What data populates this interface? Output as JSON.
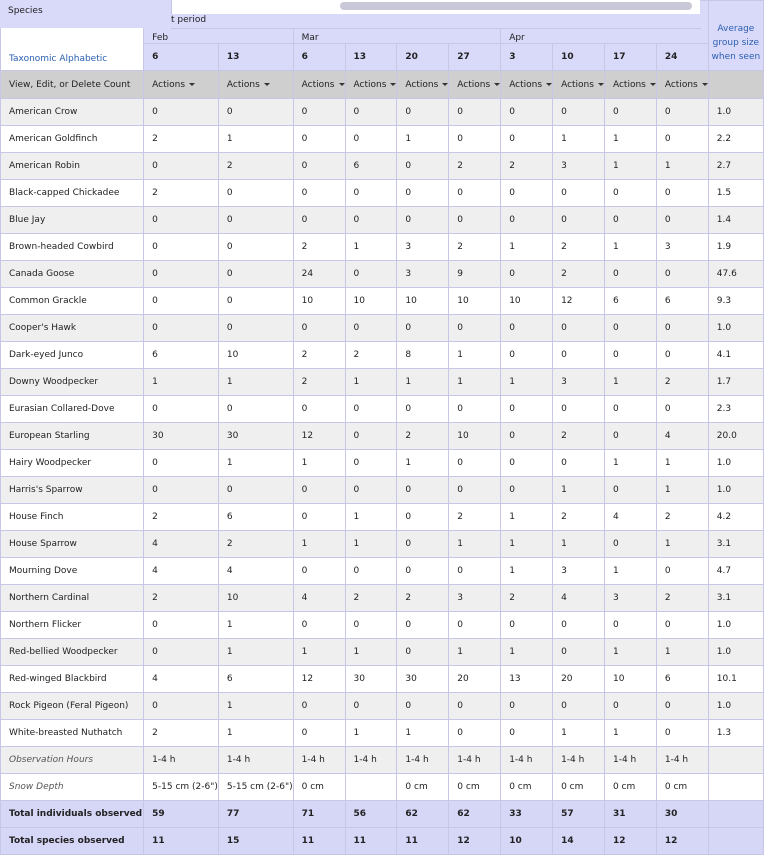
{
  "header": {
    "species_label": "Species",
    "period_label": "t period",
    "taxonomic_label": "Taxonomic Alphabetic",
    "avg_label": "Average group size when seen",
    "actions_row_label": "View, Edit, or Delete Count",
    "actions_label": "Actions",
    "months": [
      {
        "name": "Feb",
        "span": 2
      },
      {
        "name": "Mar",
        "span": 4
      },
      {
        "name": "Apr",
        "span": 4
      }
    ],
    "days": [
      "6",
      "13",
      "6",
      "13",
      "20",
      "27",
      "3",
      "10",
      "17",
      "24"
    ]
  },
  "rows": [
    {
      "species": "American Crow",
      "values": [
        "0",
        "0",
        "0",
        "0",
        "0",
        "0",
        "0",
        "0",
        "0",
        "0"
      ],
      "avg": "1.0"
    },
    {
      "species": "American Goldfinch",
      "values": [
        "2",
        "1",
        "0",
        "0",
        "1",
        "0",
        "0",
        "1",
        "1",
        "0"
      ],
      "avg": "2.2"
    },
    {
      "species": "American Robin",
      "values": [
        "0",
        "2",
        "0",
        "6",
        "0",
        "2",
        "2",
        "3",
        "1",
        "1"
      ],
      "avg": "2.7"
    },
    {
      "species": "Black-capped Chickadee",
      "values": [
        "2",
        "0",
        "0",
        "0",
        "0",
        "0",
        "0",
        "0",
        "0",
        "0"
      ],
      "avg": "1.5"
    },
    {
      "species": "Blue Jay",
      "values": [
        "0",
        "0",
        "0",
        "0",
        "0",
        "0",
        "0",
        "0",
        "0",
        "0"
      ],
      "avg": "1.4"
    },
    {
      "species": "Brown-headed Cowbird",
      "values": [
        "0",
        "0",
        "2",
        "1",
        "3",
        "2",
        "1",
        "2",
        "1",
        "3"
      ],
      "avg": "1.9"
    },
    {
      "species": "Canada Goose",
      "values": [
        "0",
        "0",
        "24",
        "0",
        "3",
        "9",
        "0",
        "2",
        "0",
        "0"
      ],
      "avg": "47.6"
    },
    {
      "species": "Common Grackle",
      "values": [
        "0",
        "0",
        "10",
        "10",
        "10",
        "10",
        "10",
        "12",
        "6",
        "6"
      ],
      "avg": "9.3"
    },
    {
      "species": "Cooper's Hawk",
      "values": [
        "0",
        "0",
        "0",
        "0",
        "0",
        "0",
        "0",
        "0",
        "0",
        "0"
      ],
      "avg": "1.0"
    },
    {
      "species": "Dark-eyed Junco",
      "values": [
        "6",
        "10",
        "2",
        "2",
        "8",
        "1",
        "0",
        "0",
        "0",
        "0"
      ],
      "avg": "4.1"
    },
    {
      "species": "Downy Woodpecker",
      "values": [
        "1",
        "1",
        "2",
        "1",
        "1",
        "1",
        "1",
        "3",
        "1",
        "2"
      ],
      "avg": "1.7"
    },
    {
      "species": "Eurasian Collared-Dove",
      "values": [
        "0",
        "0",
        "0",
        "0",
        "0",
        "0",
        "0",
        "0",
        "0",
        "0"
      ],
      "avg": "2.3"
    },
    {
      "species": "European Starling",
      "values": [
        "30",
        "30",
        "12",
        "0",
        "2",
        "10",
        "0",
        "2",
        "0",
        "4"
      ],
      "avg": "20.0"
    },
    {
      "species": "Hairy Woodpecker",
      "values": [
        "0",
        "1",
        "1",
        "0",
        "1",
        "0",
        "0",
        "0",
        "1",
        "1"
      ],
      "avg": "1.0"
    },
    {
      "species": "Harris's Sparrow",
      "values": [
        "0",
        "0",
        "0",
        "0",
        "0",
        "0",
        "0",
        "1",
        "0",
        "1"
      ],
      "avg": "1.0"
    },
    {
      "species": "House Finch",
      "values": [
        "2",
        "6",
        "0",
        "1",
        "0",
        "2",
        "1",
        "2",
        "4",
        "2"
      ],
      "avg": "4.2"
    },
    {
      "species": "House Sparrow",
      "values": [
        "4",
        "2",
        "1",
        "1",
        "0",
        "1",
        "1",
        "1",
        "0",
        "1"
      ],
      "avg": "3.1"
    },
    {
      "species": "Mourning Dove",
      "values": [
        "4",
        "4",
        "0",
        "0",
        "0",
        "0",
        "1",
        "3",
        "1",
        "0"
      ],
      "avg": "4.7"
    },
    {
      "species": "Northern Cardinal",
      "values": [
        "2",
        "10",
        "4",
        "2",
        "2",
        "3",
        "2",
        "4",
        "3",
        "2"
      ],
      "avg": "3.1"
    },
    {
      "species": "Northern Flicker",
      "values": [
        "0",
        "1",
        "0",
        "0",
        "0",
        "0",
        "0",
        "0",
        "0",
        "0"
      ],
      "avg": "1.0"
    },
    {
      "species": "Red-bellied Woodpecker",
      "values": [
        "0",
        "1",
        "1",
        "1",
        "0",
        "1",
        "1",
        "0",
        "1",
        "1"
      ],
      "avg": "1.0"
    },
    {
      "species": "Red-winged Blackbird",
      "values": [
        "4",
        "6",
        "12",
        "30",
        "30",
        "20",
        "13",
        "20",
        "10",
        "6"
      ],
      "avg": "10.1"
    },
    {
      "species": "Rock Pigeon (Feral Pigeon)",
      "values": [
        "0",
        "1",
        "0",
        "0",
        "0",
        "0",
        "0",
        "0",
        "0",
        "0"
      ],
      "avg": "1.0"
    },
    {
      "species": "White-breasted Nuthatch",
      "values": [
        "2",
        "1",
        "0",
        "1",
        "1",
        "0",
        "0",
        "1",
        "1",
        "0"
      ],
      "avg": "1.3"
    }
  ],
  "meta_rows": [
    {
      "label": "Observation Hours",
      "values": [
        "1-4 h",
        "1-4 h",
        "1-4 h",
        "1-4 h",
        "1-4 h",
        "1-4 h",
        "1-4 h",
        "1-4 h",
        "1-4 h",
        "1-4 h"
      ]
    },
    {
      "label": "Snow Depth",
      "values": [
        "5-15 cm (2-6\")",
        "5-15 cm (2-6\")",
        "0 cm",
        "",
        "0 cm",
        "0 cm",
        "0 cm",
        "0 cm",
        "0 cm",
        "0 cm"
      ]
    }
  ],
  "totals": [
    {
      "label": "Total individuals observed",
      "values": [
        "59",
        "77",
        "71",
        "56",
        "62",
        "62",
        "33",
        "57",
        "31",
        "30"
      ]
    },
    {
      "label": "Total species observed",
      "values": [
        "11",
        "15",
        "11",
        "11",
        "11",
        "12",
        "10",
        "14",
        "12",
        "12"
      ]
    }
  ]
}
